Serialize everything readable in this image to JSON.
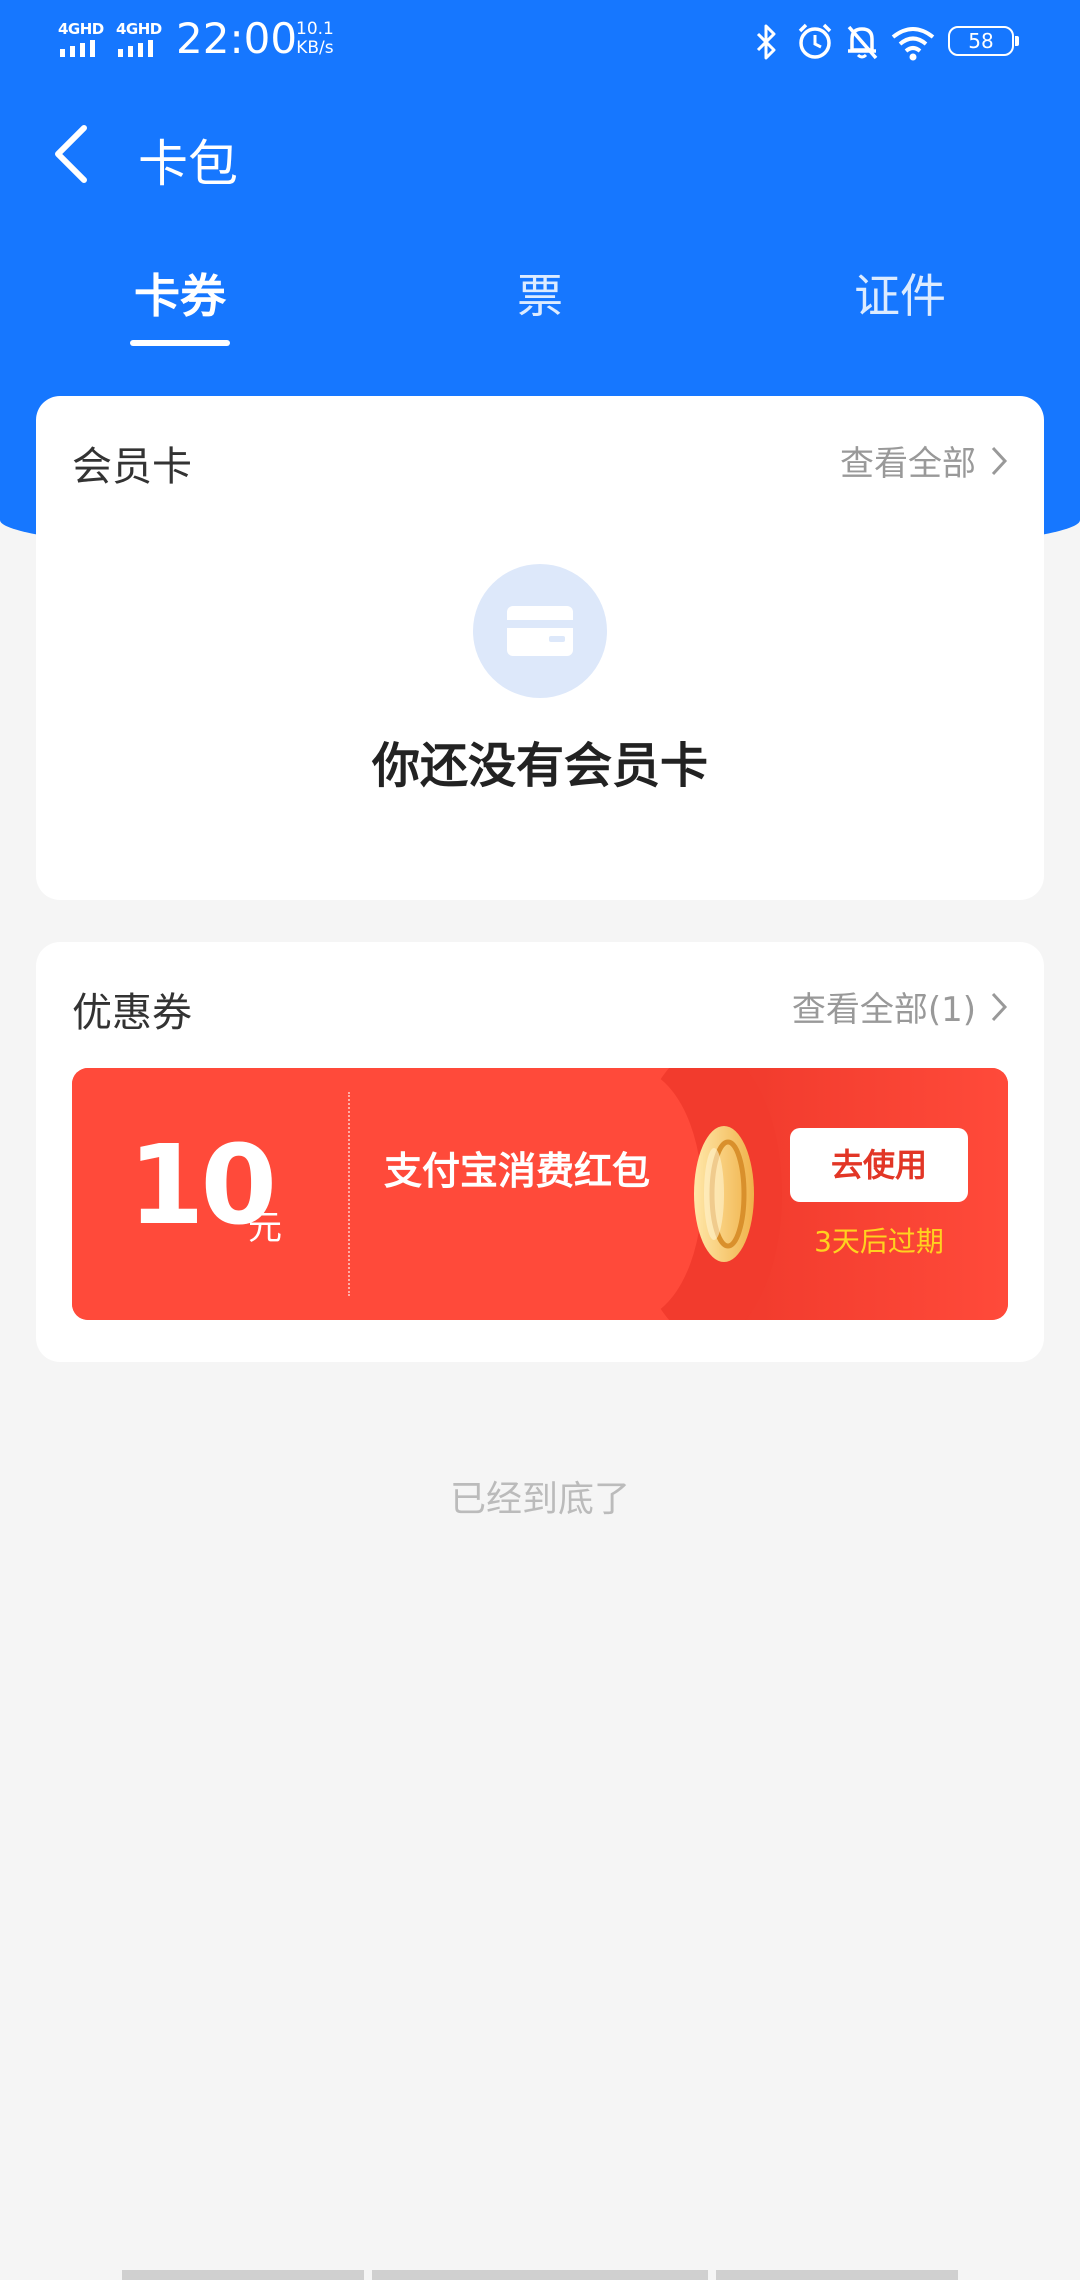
{
  "status_bar": {
    "sim1_network": "4GHD",
    "sim2_network": "4GHD",
    "time": "22:00",
    "speed_value": "10.1",
    "speed_unit": "KB/s",
    "battery": "58",
    "icons": [
      "bluetooth-icon",
      "alarm-icon",
      "mute-icon",
      "wifi-icon",
      "battery-icon"
    ]
  },
  "nav": {
    "title": "卡包",
    "tabs": [
      {
        "label": "卡券",
        "active": true
      },
      {
        "label": "票",
        "active": false
      },
      {
        "label": "证件",
        "active": false
      }
    ]
  },
  "member_card": {
    "title": "会员卡",
    "more_label": "查看全部",
    "empty_text": "你还没有会员卡"
  },
  "coupons": {
    "title": "优惠券",
    "more_label": "查看全部(1)",
    "items": [
      {
        "amount": "10",
        "unit": "元",
        "name": "支付宝消费红包",
        "action_label": "去使用",
        "expire_text": "3天后过期"
      }
    ]
  },
  "footer": {
    "end_text": "已经到底了"
  },
  "colors": {
    "primary": "#1677ff",
    "coupon_red": "#ff4a3a",
    "expire_yellow": "#ffd21f",
    "background": "#f5f5f5"
  }
}
